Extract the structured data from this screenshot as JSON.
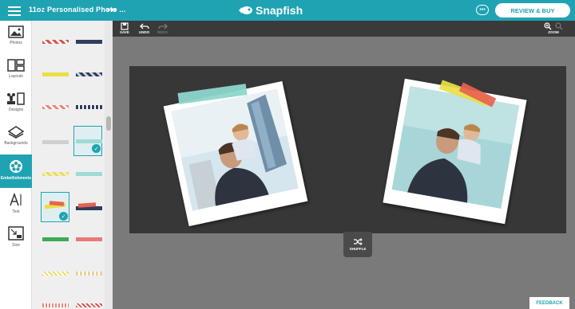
{
  "header": {
    "title": "11oz Personalised Photo ...",
    "more": "•••",
    "brand": "Snapfish",
    "chat_icon": "chat-bubble-icon",
    "review_button": "REVIEW & BUY"
  },
  "sidebar": {
    "items": [
      {
        "label": "Photos",
        "icon": "photos-icon"
      },
      {
        "label": "Layouts",
        "icon": "layouts-icon"
      },
      {
        "label": "Designs",
        "icon": "designs-icon"
      },
      {
        "label": "Backgrounds",
        "icon": "backgrounds-icon"
      },
      {
        "label": "Embellishments",
        "icon": "embellishments-icon",
        "active": true
      },
      {
        "label": "Text",
        "icon": "text-icon"
      },
      {
        "label": "Size",
        "icon": "size-icon"
      }
    ]
  },
  "toolbar": {
    "save": "SAVE",
    "undo": "UNDO",
    "redo": "REDO",
    "zoom": "ZOOM"
  },
  "canvas": {
    "shuffle_label": "SHUFFLE"
  },
  "feedback": "FEEDBACK",
  "colors": {
    "accent": "#1fa3b3",
    "canvas": "#373737",
    "workspace": "#7a7a7a"
  }
}
